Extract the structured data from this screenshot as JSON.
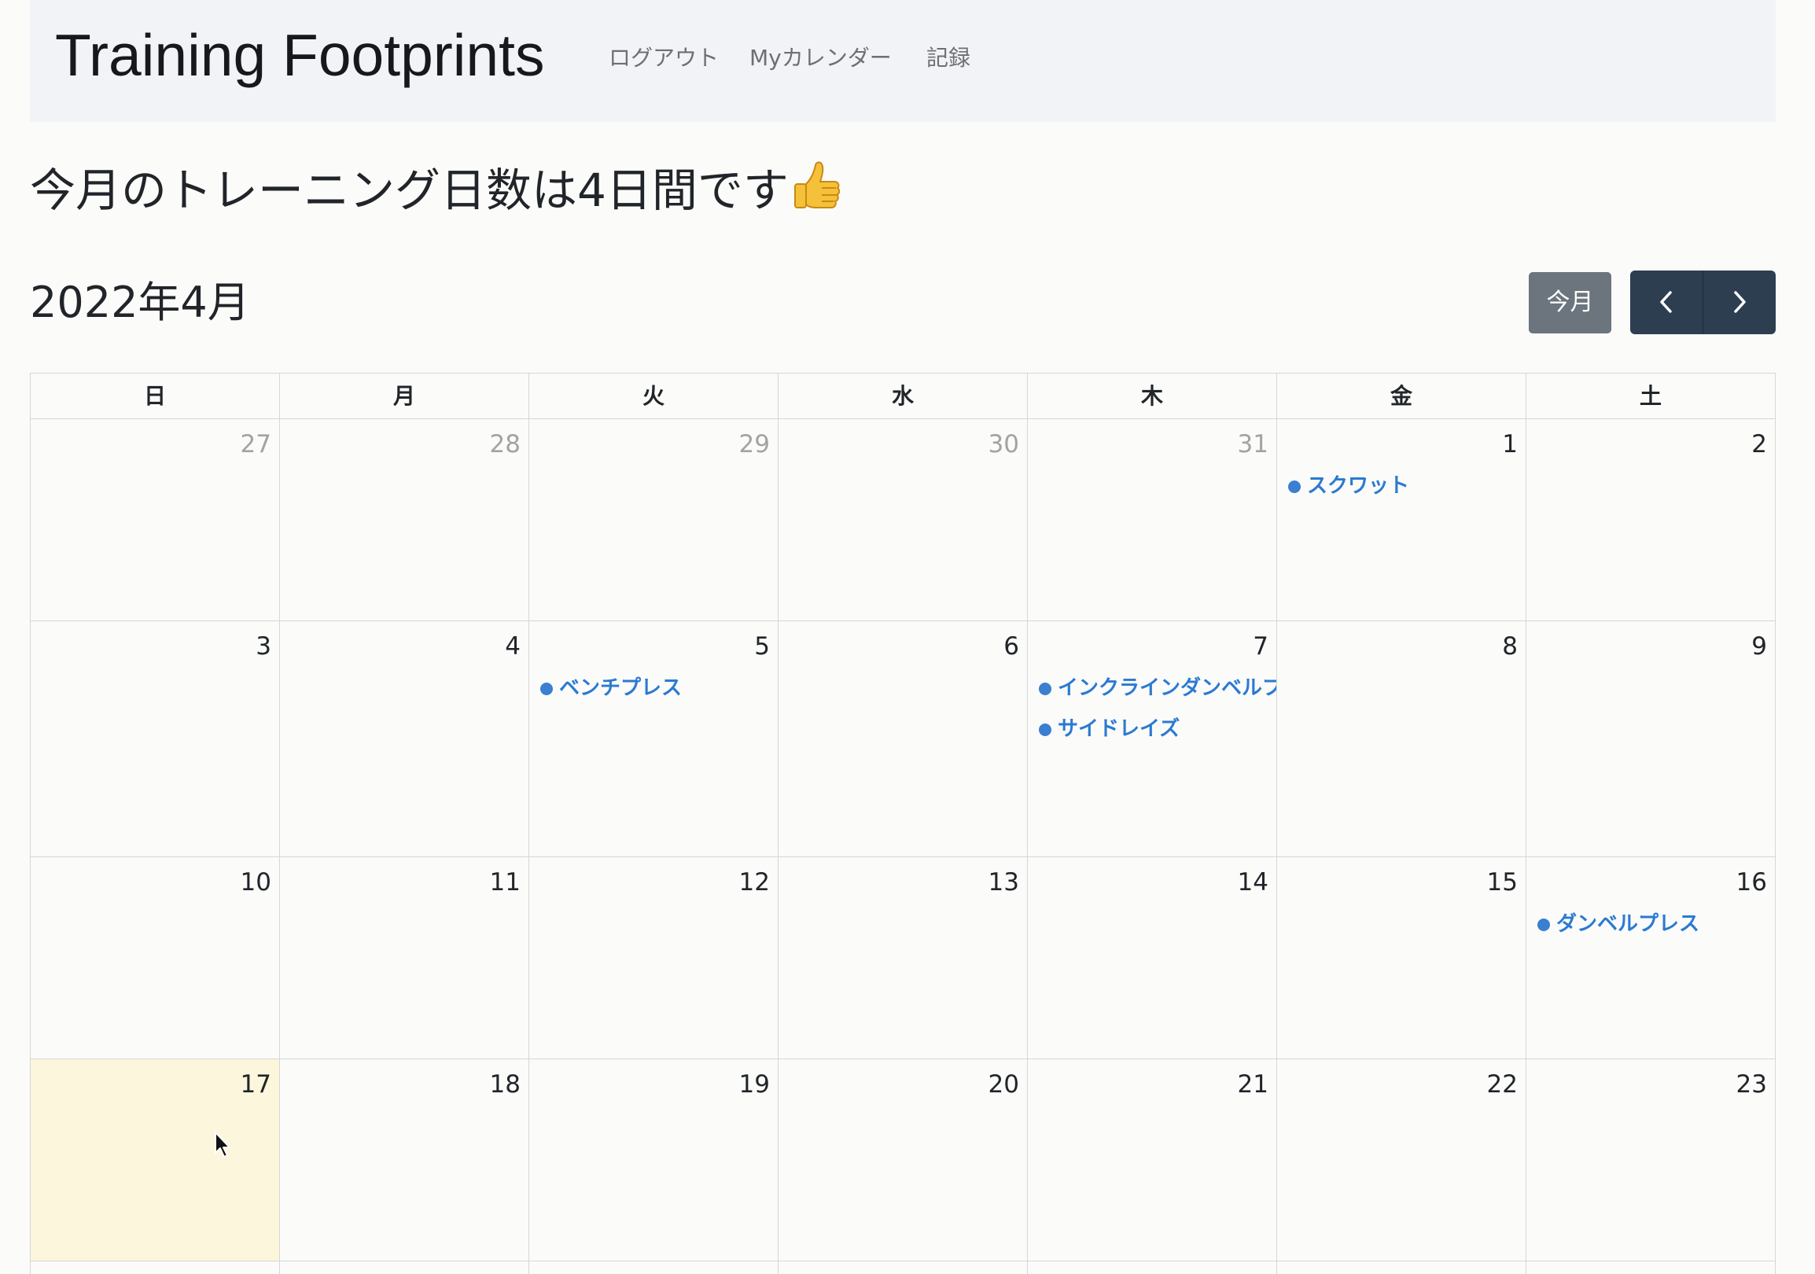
{
  "navbar": {
    "brand": "Training Footprints",
    "links": [
      "ログアウト",
      "Myカレンダー",
      "記録"
    ]
  },
  "summary": {
    "text": "今月のトレーニング日数は4日間です",
    "icon": "thumbs-up-icon"
  },
  "calendar": {
    "title": "2022年4月",
    "today_label": "今月",
    "prev_icon": "chevron-left-icon",
    "next_icon": "chevron-right-icon",
    "weekdays": [
      "日",
      "月",
      "火",
      "水",
      "木",
      "金",
      "土"
    ],
    "weeks": [
      [
        {
          "day": "27",
          "other_month": true,
          "events": []
        },
        {
          "day": "28",
          "other_month": true,
          "events": []
        },
        {
          "day": "29",
          "other_month": true,
          "events": []
        },
        {
          "day": "30",
          "other_month": true,
          "events": []
        },
        {
          "day": "31",
          "other_month": true,
          "events": []
        },
        {
          "day": "1",
          "other_month": false,
          "events": [
            "スクワット"
          ]
        },
        {
          "day": "2",
          "other_month": false,
          "events": []
        }
      ],
      [
        {
          "day": "3",
          "other_month": false,
          "events": []
        },
        {
          "day": "4",
          "other_month": false,
          "events": []
        },
        {
          "day": "5",
          "other_month": false,
          "events": [
            "ベンチプレス"
          ]
        },
        {
          "day": "6",
          "other_month": false,
          "events": []
        },
        {
          "day": "7",
          "other_month": false,
          "events": [
            "インクラインダンベルプ",
            "サイドレイズ"
          ]
        },
        {
          "day": "8",
          "other_month": false,
          "events": []
        },
        {
          "day": "9",
          "other_month": false,
          "events": []
        }
      ],
      [
        {
          "day": "10",
          "other_month": false,
          "events": []
        },
        {
          "day": "11",
          "other_month": false,
          "events": []
        },
        {
          "day": "12",
          "other_month": false,
          "events": []
        },
        {
          "day": "13",
          "other_month": false,
          "events": []
        },
        {
          "day": "14",
          "other_month": false,
          "events": []
        },
        {
          "day": "15",
          "other_month": false,
          "events": []
        },
        {
          "day": "16",
          "other_month": false,
          "events": [
            "ダンベルプレス"
          ]
        }
      ],
      [
        {
          "day": "17",
          "other_month": false,
          "today": true,
          "events": []
        },
        {
          "day": "18",
          "other_month": false,
          "events": []
        },
        {
          "day": "19",
          "other_month": false,
          "events": []
        },
        {
          "day": "20",
          "other_month": false,
          "events": []
        },
        {
          "day": "21",
          "other_month": false,
          "events": []
        },
        {
          "day": "22",
          "other_month": false,
          "events": []
        },
        {
          "day": "23",
          "other_month": false,
          "events": []
        }
      ],
      [
        {
          "day": "",
          "other_month": false,
          "events": []
        },
        {
          "day": "",
          "other_month": false,
          "events": []
        },
        {
          "day": "",
          "other_month": false,
          "events": []
        },
        {
          "day": "",
          "other_month": false,
          "events": []
        },
        {
          "day": "",
          "other_month": false,
          "events": []
        },
        {
          "day": "",
          "other_month": false,
          "events": []
        },
        {
          "day": "",
          "other_month": false,
          "events": []
        }
      ]
    ]
  },
  "colors": {
    "event": "#2b7ad1",
    "today_bg": "#fcf6dc",
    "nav_buttons": "#2c3e50",
    "today_button": "#6c757d"
  }
}
